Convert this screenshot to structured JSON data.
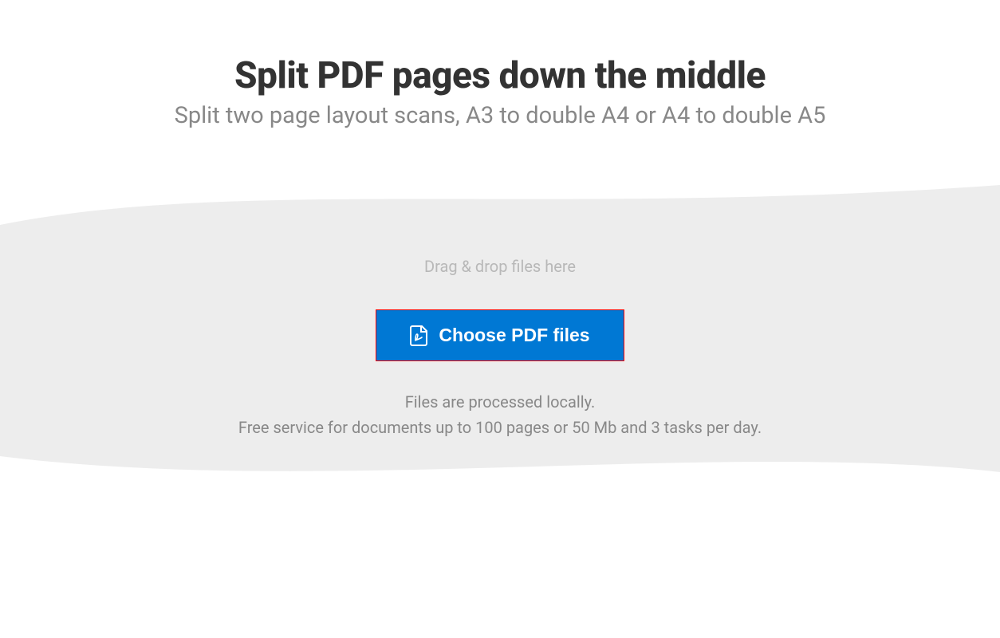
{
  "header": {
    "title": "Split PDF pages down the middle",
    "subtitle": "Split two page layout scans, A3 to double A4 or A4 to double A5"
  },
  "dropzone": {
    "drag_text": "Drag & drop files here",
    "button_label": "Choose PDF files",
    "info_line1": "Files are processed locally.",
    "info_line2": "Free service for documents up to 100 pages or 50 Mb and 3 tasks per day."
  },
  "colors": {
    "button_bg": "#0078d4",
    "button_highlight_border": "#ff0000",
    "wave_bg": "#ededed"
  }
}
